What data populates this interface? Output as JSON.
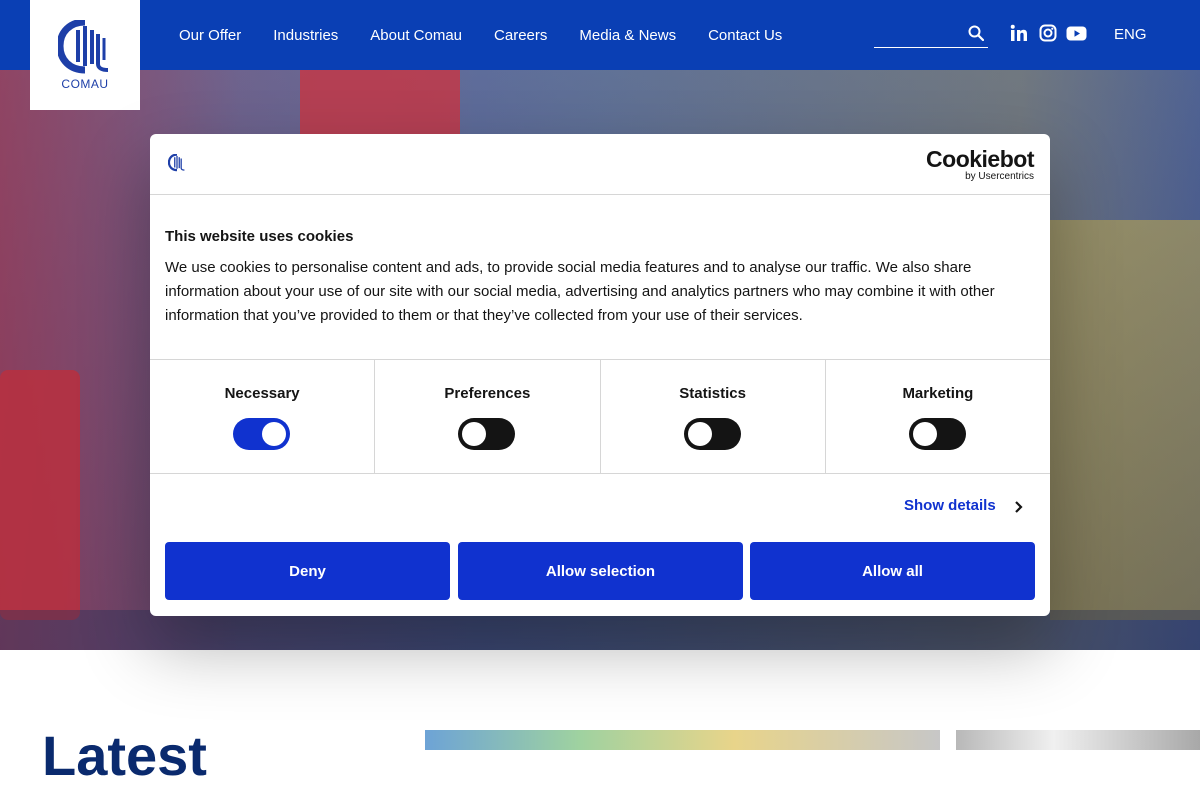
{
  "header": {
    "logo_text": "COMAU",
    "nav": [
      "Our Offer",
      "Industries",
      "About Comau",
      "Careers",
      "Media & News",
      "Contact Us"
    ],
    "search_placeholder": "",
    "social_icons": [
      "linkedin-icon",
      "instagram-icon",
      "youtube-icon"
    ],
    "language": "ENG"
  },
  "hero": {
    "background_label": ""
  },
  "cookie_dialog": {
    "brand_name": "Cookiebot",
    "brand_sub": "by Usercentrics",
    "title": "This website uses cookies",
    "body": "We use cookies to personalise content and ads, to provide social media features and to analyse our traffic. We also share information about your use of our site with our social media, advertising and analytics partners who may combine it with other information that you’ve provided to them or that they’ve collected from your use of their services.",
    "categories": [
      {
        "label": "Necessary",
        "enabled": true
      },
      {
        "label": "Preferences",
        "enabled": false
      },
      {
        "label": "Statistics",
        "enabled": false
      },
      {
        "label": "Marketing",
        "enabled": false
      }
    ],
    "show_details": "Show details",
    "buttons": {
      "deny": "Deny",
      "allow_selection": "Allow selection",
      "allow_all": "Allow all"
    }
  },
  "section": {
    "title": "Latest"
  },
  "colors": {
    "header_blue": "#0a3fb4",
    "button_blue": "#1032cf",
    "toggle_off": "#141414"
  }
}
